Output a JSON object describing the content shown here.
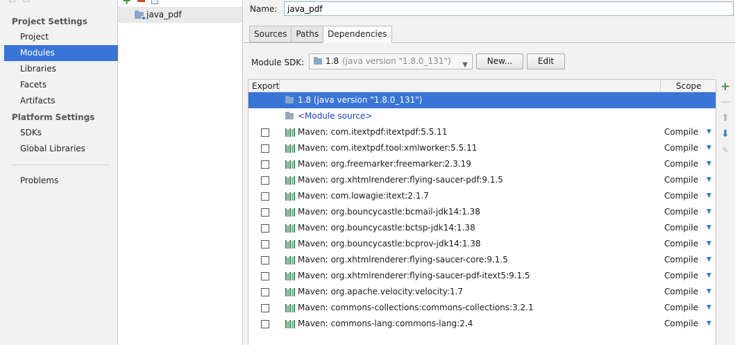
{
  "sidebar": {
    "project_settings_title": "Project Settings",
    "platform_settings_title": "Platform Settings",
    "items": {
      "project": "Project",
      "modules": "Modules",
      "libraries": "Libraries",
      "facets": "Facets",
      "artifacts": "Artifacts",
      "sdks": "SDKs",
      "global_libraries": "Global Libraries",
      "problems": "Problems"
    },
    "selected": "Modules",
    "icons": [
      "back-arrow-icon",
      "forward-arrow-icon"
    ]
  },
  "tree": {
    "toolbar_icons": [
      "add-icon",
      "remove-icon",
      "copy-icon"
    ],
    "modules": [
      {
        "name": "java_pdf",
        "icon": "module-folder-icon"
      }
    ]
  },
  "module": {
    "name_label": "Name:",
    "name_value": "java_pdf",
    "tabs": [
      "Sources",
      "Paths",
      "Dependencies"
    ],
    "active_tab": "Dependencies",
    "sdk_label": "Module SDK:",
    "sdk_value": "1.8",
    "sdk_detail": "(java version \"1.8.0_131\")",
    "new_button": "New...",
    "edit_button": "Edit"
  },
  "dependencies": {
    "columns": {
      "export": "Export",
      "scope": "Scope"
    },
    "sdk_row": {
      "label": "1.8 (java version \"1.8.0_131\")",
      "icon": "sdk-folder-icon"
    },
    "module_source_row": {
      "label": "<Module source>",
      "icon": "source-folder-icon"
    },
    "rows": [
      {
        "label": "Maven: com.itextpdf:itextpdf:5.5.11",
        "scope": "Compile"
      },
      {
        "label": "Maven: com.itextpdf.tool:xmlworker:5.5.11",
        "scope": "Compile"
      },
      {
        "label": "Maven: org.freemarker:freemarker:2.3.19",
        "scope": "Compile"
      },
      {
        "label": "Maven: org.xhtmlrenderer:flying-saucer-pdf:9.1.5",
        "scope": "Compile"
      },
      {
        "label": "Maven: com.lowagie:itext:2.1.7",
        "scope": "Compile"
      },
      {
        "label": "Maven: org.bouncycastle:bcmail-jdk14:1.38",
        "scope": "Compile"
      },
      {
        "label": "Maven: org.bouncycastle:bctsp-jdk14:1.38",
        "scope": "Compile"
      },
      {
        "label": "Maven: org.bouncycastle:bcprov-jdk14:1.38",
        "scope": "Compile"
      },
      {
        "label": "Maven: org.xhtmlrenderer:flying-saucer-core:9.1.5",
        "scope": "Compile"
      },
      {
        "label": "Maven: org.xhtmlrenderer:flying-saucer-pdf-itext5:9.1.5",
        "scope": "Compile"
      },
      {
        "label": "Maven: org.apache.velocity:velocity:1.7",
        "scope": "Compile"
      },
      {
        "label": "Maven: commons-collections:commons-collections:3.2.1",
        "scope": "Compile"
      },
      {
        "label": "Maven: commons-lang:commons-lang:2.4",
        "scope": "Compile"
      }
    ],
    "side_toolbar_icons": [
      "add-dependency-icon",
      "remove-dependency-icon",
      "move-up-icon",
      "move-down-icon",
      "edit-dependency-icon"
    ]
  },
  "colors": {
    "selection": "#3875d7",
    "link": "#1f3fd0",
    "add_green": "#3a9a3a",
    "scope_arrow": "#2f7bd1",
    "maven_icon": "#3a8a5a"
  }
}
